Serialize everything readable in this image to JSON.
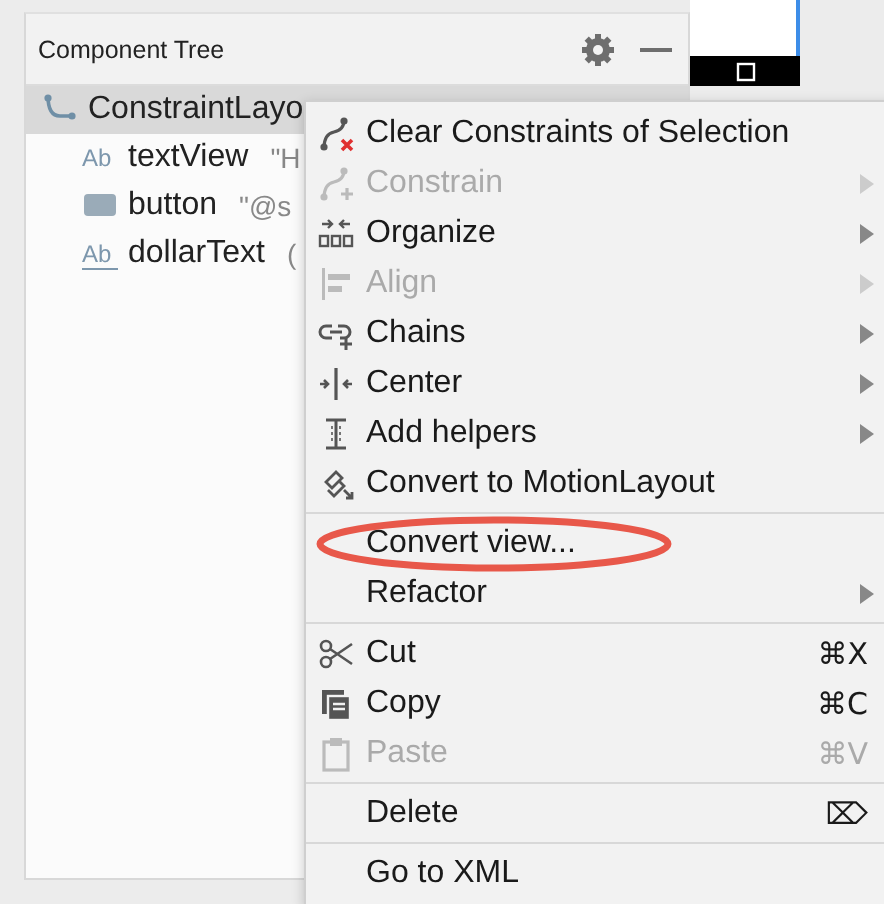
{
  "panel": {
    "title": "Component Tree"
  },
  "tree": [
    {
      "name": "ConstraintLayo",
      "selected": true,
      "children": [
        {
          "name": "textView",
          "icon_text": "Ab",
          "detail": "\"H",
          "selected": false
        },
        {
          "name": "button",
          "detail": "\"@s",
          "selected": false
        },
        {
          "name": "dollarText",
          "icon_text": "Ab",
          "detail": "(",
          "selected": false
        }
      ]
    }
  ],
  "context_menu": [
    {
      "kind": "item",
      "label": "Clear Constraints of Selection",
      "disabled": false,
      "submenu": false
    },
    {
      "kind": "item",
      "label": "Constrain",
      "disabled": true,
      "submenu": true
    },
    {
      "kind": "item",
      "label": "Organize",
      "disabled": false,
      "submenu": true
    },
    {
      "kind": "item",
      "label": "Align",
      "disabled": true,
      "submenu": true
    },
    {
      "kind": "item",
      "label": "Chains",
      "disabled": false,
      "submenu": true
    },
    {
      "kind": "item",
      "label": "Center",
      "disabled": false,
      "submenu": true
    },
    {
      "kind": "item",
      "label": "Add helpers",
      "disabled": false,
      "submenu": true
    },
    {
      "kind": "item",
      "label": "Convert to MotionLayout",
      "disabled": false,
      "submenu": false
    },
    {
      "kind": "separator"
    },
    {
      "kind": "item",
      "label": "Convert view...",
      "disabled": false,
      "submenu": false,
      "circled": true
    },
    {
      "kind": "item",
      "label": "Refactor",
      "disabled": false,
      "submenu": true
    },
    {
      "kind": "separator"
    },
    {
      "kind": "item",
      "label": "Cut",
      "shortcut": "⌘X",
      "disabled": false,
      "submenu": false
    },
    {
      "kind": "item",
      "label": "Copy",
      "shortcut": "⌘C",
      "disabled": false,
      "submenu": false
    },
    {
      "kind": "item",
      "label": "Paste",
      "shortcut": "⌘V",
      "disabled": true,
      "submenu": false
    },
    {
      "kind": "separator"
    },
    {
      "kind": "item",
      "label": "Delete",
      "shortcut": "⌦",
      "disabled": false,
      "submenu": false
    },
    {
      "kind": "separator"
    },
    {
      "kind": "item",
      "label": "Go to XML",
      "disabled": false,
      "submenu": false
    }
  ]
}
